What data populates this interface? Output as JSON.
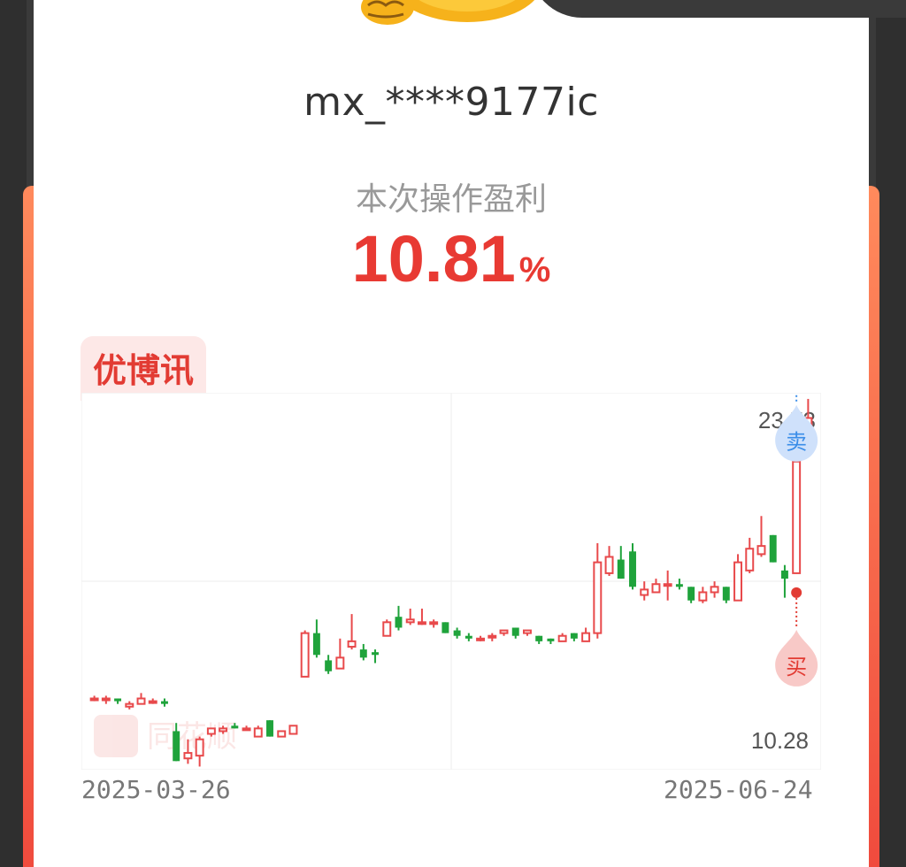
{
  "card": {
    "username": "mx_****9177ic",
    "profit_label": "本次操作盈利",
    "profit_value": "10.81",
    "profit_unit": "%",
    "stock_name": "优博讯"
  },
  "chart_data": {
    "type": "candlestick",
    "price_high_label": "23.73",
    "price_low_label": "10.28",
    "y_range": [
      10.28,
      23.73
    ],
    "date_start": "2025-03-26",
    "date_end": "2025-06-24",
    "buy_label": "买",
    "sell_label": "卖",
    "watermark": "同花顺",
    "colors": {
      "up": "#e8494b",
      "down": "#1fa33b",
      "buy": "#e23b33",
      "sell": "#3a8de8"
    },
    "candles": [
      [
        12.7,
        12.7,
        12.8,
        12.6
      ],
      [
        12.7,
        12.7,
        12.8,
        12.5
      ],
      [
        12.7,
        12.6,
        12.7,
        12.5
      ],
      [
        12.4,
        12.5,
        12.6,
        12.3
      ],
      [
        12.5,
        12.7,
        12.9,
        12.5
      ],
      [
        12.6,
        12.6,
        12.7,
        12.5
      ],
      [
        12.6,
        12.5,
        12.7,
        12.4
      ],
      [
        11.5,
        10.4,
        11.8,
        10.4
      ],
      [
        10.5,
        10.7,
        11.2,
        10.3
      ],
      [
        10.6,
        11.2,
        11.3,
        10.2
      ],
      [
        11.4,
        11.6,
        11.6,
        11.3
      ],
      [
        11.5,
        11.6,
        11.7,
        11.4
      ],
      [
        11.7,
        11.6,
        11.8,
        11.6
      ],
      [
        11.6,
        11.6,
        11.7,
        11.6
      ],
      [
        11.3,
        11.6,
        11.7,
        11.3
      ],
      [
        11.9,
        11.3,
        11.9,
        11.3
      ],
      [
        11.3,
        11.5,
        11.5,
        11.3
      ],
      [
        11.4,
        11.7,
        11.7,
        11.4
      ],
      [
        13.5,
        15.1,
        15.2,
        13.5
      ],
      [
        15.1,
        14.3,
        15.6,
        14.2
      ],
      [
        14.1,
        13.7,
        14.3,
        13.6
      ],
      [
        13.8,
        14.2,
        14.9,
        13.8
      ],
      [
        14.6,
        14.8,
        15.8,
        14.5
      ],
      [
        14.5,
        14.2,
        14.7,
        14.1
      ],
      [
        14.4,
        14.3,
        14.5,
        14.0
      ],
      [
        15.0,
        15.5,
        15.6,
        15.0
      ],
      [
        15.7,
        15.3,
        16.1,
        15.2
      ],
      [
        15.5,
        15.6,
        16.0,
        15.4
      ],
      [
        15.5,
        15.5,
        16.0,
        15.4
      ],
      [
        15.5,
        15.5,
        15.6,
        15.3
      ],
      [
        15.5,
        15.1,
        15.5,
        15.1
      ],
      [
        15.2,
        15.0,
        15.3,
        14.9
      ],
      [
        15.0,
        14.9,
        15.1,
        14.8
      ],
      [
        14.9,
        14.9,
        15.0,
        14.8
      ],
      [
        15.0,
        15.0,
        15.1,
        14.8
      ],
      [
        15.1,
        15.2,
        15.2,
        15.0
      ],
      [
        15.3,
        15.0,
        15.3,
        14.9
      ],
      [
        15.1,
        15.2,
        15.2,
        15.0
      ],
      [
        15.0,
        14.8,
        15.0,
        14.7
      ],
      [
        14.9,
        14.8,
        14.9,
        14.7
      ],
      [
        14.8,
        15.0,
        15.1,
        14.8
      ],
      [
        15.1,
        14.9,
        15.1,
        14.8
      ],
      [
        14.8,
        15.1,
        15.3,
        14.8
      ],
      [
        15.1,
        17.7,
        18.4,
        14.9
      ],
      [
        17.3,
        17.9,
        18.3,
        17.2
      ],
      [
        17.8,
        17.1,
        18.3,
        17.1
      ],
      [
        18.1,
        16.8,
        18.4,
        16.7
      ],
      [
        16.5,
        16.7,
        17.0,
        16.3
      ],
      [
        16.6,
        16.9,
        17.1,
        16.6
      ],
      [
        16.9,
        16.9,
        17.4,
        16.3
      ],
      [
        16.9,
        16.8,
        17.1,
        16.7
      ],
      [
        16.8,
        16.3,
        16.8,
        16.2
      ],
      [
        16.3,
        16.6,
        16.8,
        16.2
      ],
      [
        16.6,
        16.8,
        17.0,
        16.4
      ],
      [
        16.8,
        16.3,
        16.8,
        16.2
      ],
      [
        16.3,
        17.7,
        18.0,
        16.3
      ],
      [
        17.4,
        18.2,
        18.6,
        17.3
      ],
      [
        18.0,
        18.3,
        19.4,
        17.9
      ],
      [
        18.7,
        17.7,
        18.7,
        17.7
      ],
      [
        17.4,
        17.1,
        17.6,
        16.4
      ],
      [
        17.3,
        21.4,
        21.4,
        17.3
      ],
      [
        22.5,
        23.0,
        23.7,
        22.1
      ]
    ],
    "buy_index": 60,
    "sell_index": 60
  }
}
